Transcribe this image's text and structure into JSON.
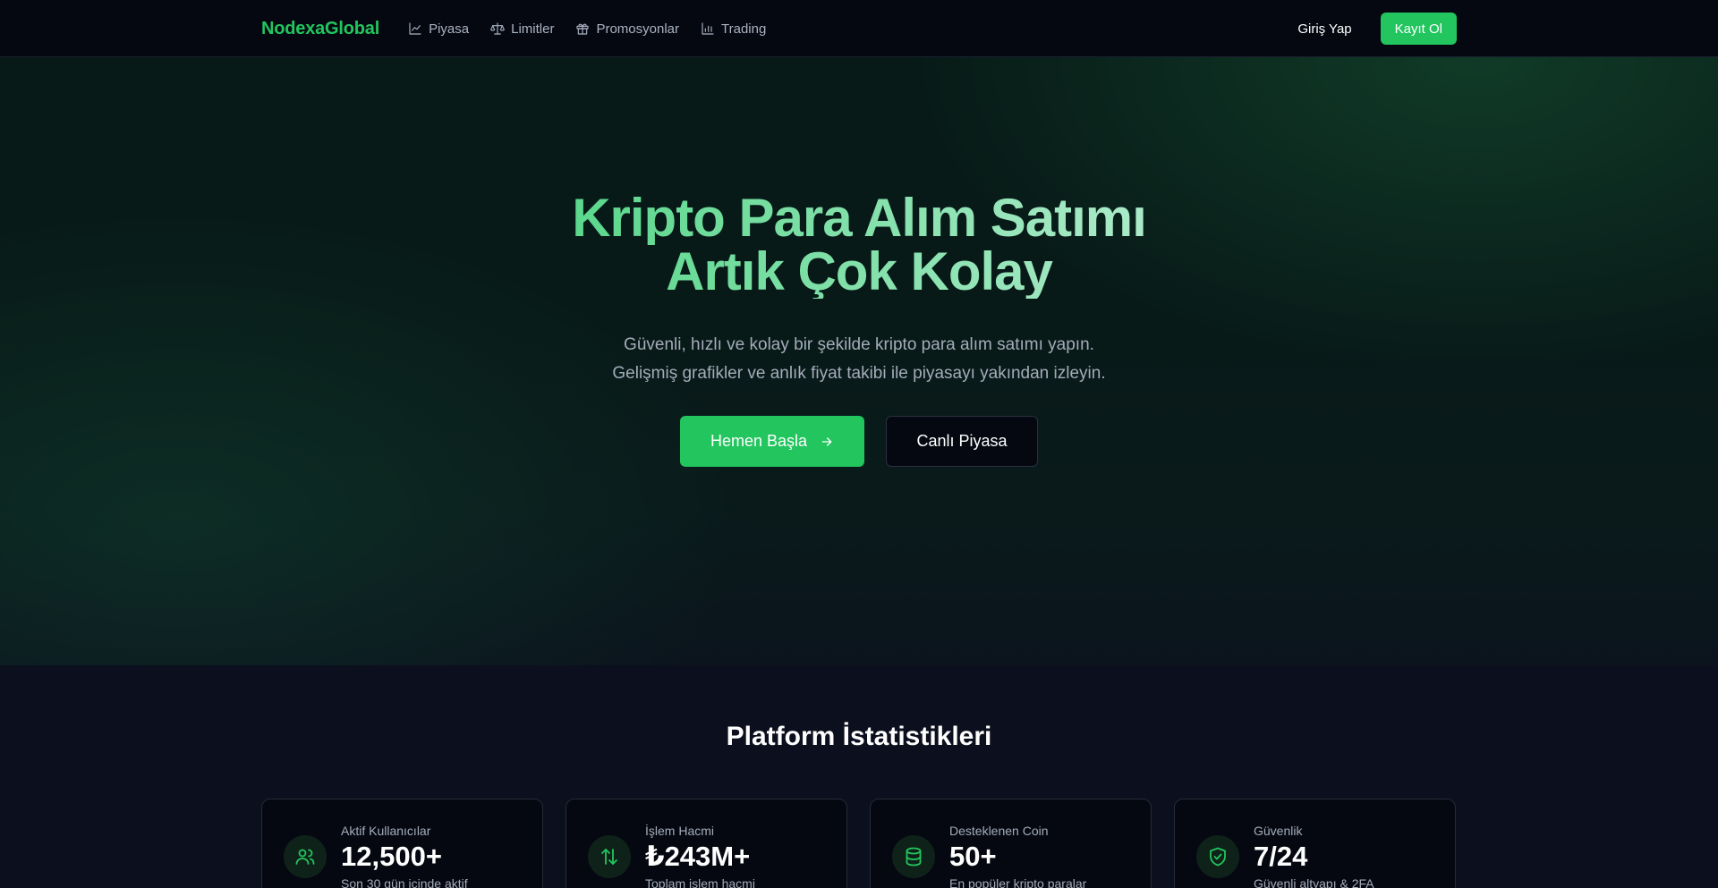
{
  "brand": "NodexaGlobal",
  "nav": {
    "links": [
      {
        "label": "Piyasa",
        "icon": "line-chart-icon"
      },
      {
        "label": "Limitler",
        "icon": "scale-icon"
      },
      {
        "label": "Promosyonlar",
        "icon": "gift-icon"
      },
      {
        "label": "Trading",
        "icon": "bar-chart-icon"
      }
    ],
    "login": "Giriş Yap",
    "signup": "Kayıt Ol"
  },
  "hero": {
    "title_line1": "Kripto Para Alım Satımı",
    "title_line2": "Artık Çok Kolay",
    "subtitle_line1": "Güvenli, hızlı ve kolay bir şekilde kripto para alım satımı yapın.",
    "subtitle_line2": "Gelişmiş grafikler ve anlık fiyat takibi ile piyasayı yakından izleyin.",
    "primary_button": "Hemen Başla",
    "secondary_button": "Canlı Piyasa"
  },
  "stats": {
    "title": "Platform İstatistikleri",
    "cards": [
      {
        "label": "Aktif Kullanıcılar",
        "value": "12,500+",
        "desc": "Son 30 gün içinde aktif",
        "icon": "users-icon"
      },
      {
        "label": "İşlem Hacmi",
        "value": "₺243M+",
        "desc": "Toplam işlem hacmi",
        "icon": "arrows-up-down-icon"
      },
      {
        "label": "Desteklenen Coin",
        "value": "50+",
        "desc": "En popüler kripto paralar",
        "icon": "database-icon"
      },
      {
        "label": "Güvenlik",
        "value": "7/24",
        "desc": "Güvenli altyapı & 2FA",
        "icon": "shield-check-icon"
      }
    ]
  },
  "colors": {
    "accent": "#22c55e",
    "background": "#0c0f1d",
    "navbar": "#050811"
  }
}
